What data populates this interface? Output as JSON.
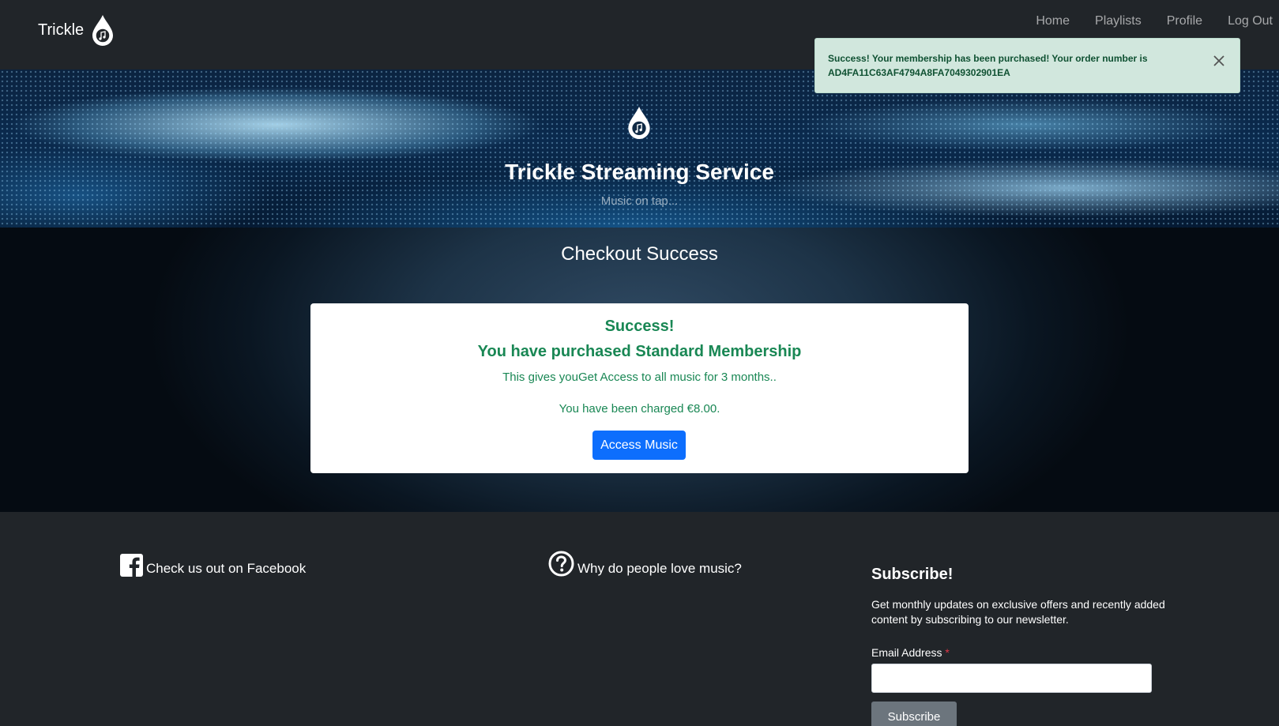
{
  "navbar": {
    "brand": "Trickle",
    "brand_icon": "music-drop-icon",
    "links": [
      "Home",
      "Playlists",
      "Profile",
      "Log Out"
    ]
  },
  "toast": {
    "line1": "Success! Your membership has been purchased! Your order number is",
    "line2": "AD4FA11C63AF4794A8FA7049302901EA",
    "close_icon": "close-icon"
  },
  "hero": {
    "title": "Trickle Streaming Service",
    "subtitle": "Music on tap..."
  },
  "main": {
    "title": "Checkout Success",
    "card": {
      "heading": "Success!",
      "subheading": "You have purchased Standard Membership",
      "description": "This gives youGet Access to all music for 3 months..",
      "charged": "You have been charged €8.00.",
      "button": "Access Music"
    }
  },
  "footer": {
    "facebook": "Check us out on Facebook",
    "question": "Why do people love music?",
    "subscribe": {
      "title": "Subscribe!",
      "text": "Get monthly updates on exclusive offers and recently added content by subscribing to our newsletter.",
      "email_label": "Email Address",
      "required_mark": "*",
      "button": "Subscribe"
    }
  },
  "colors": {
    "success_text": "#198754",
    "toast_bg": "#d1e7dd",
    "primary": "#0d6efd",
    "dark": "#212529"
  }
}
